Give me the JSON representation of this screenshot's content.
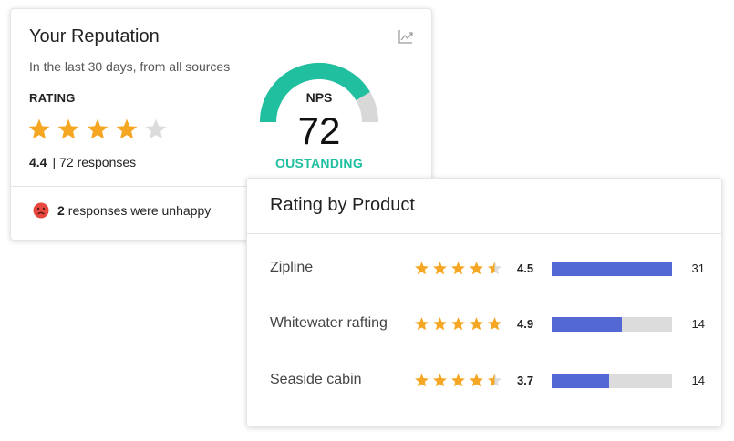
{
  "reputation": {
    "title": "Your Reputation",
    "subtitle": "In the last 30 days, from all sources",
    "rating_label": "RATING",
    "star_rating": 4,
    "star_max": 5,
    "score": "4.4",
    "separator": "|",
    "responses": "72 responses",
    "nps": {
      "label": "NPS",
      "value": "72",
      "status": "OUSTANDING",
      "fill_fraction": 0.83,
      "color": "#1fbf9f"
    },
    "unhappy": {
      "count": "2",
      "text": "responses were unhappy",
      "icon": "sad-face-icon"
    },
    "trend_icon": "trend-chart-icon"
  },
  "products": {
    "title": "Rating by Product",
    "star_color": "#f5a623",
    "bar_color": "#5468d4",
    "rows": [
      {
        "name": "Zipline",
        "stars": 4.5,
        "score": "4.5",
        "bar_fraction": 1.0,
        "count": "31"
      },
      {
        "name": "Whitewater rafting",
        "stars": 5,
        "score": "4.9",
        "bar_fraction": 0.58,
        "count": "14"
      },
      {
        "name": "Seaside cabin",
        "stars": 4.5,
        "score": "3.7",
        "bar_fraction": 0.48,
        "count": "14"
      }
    ]
  }
}
